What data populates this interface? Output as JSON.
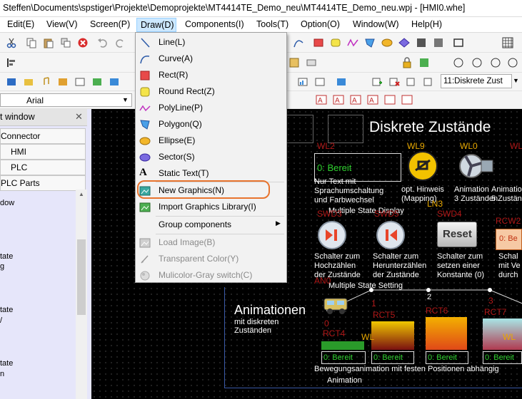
{
  "titlebar": {
    "text": "Steffen\\Documents\\spstiger\\Projekte\\Demoprojekte\\MT4414TE_Demo_neu\\MT4414TE_Demo_neu.wpj - [HMI0.whe]"
  },
  "menubar": {
    "items": [
      "Edit(E)",
      "View(V)",
      "Screen(P)",
      "Draw(D)",
      "Components(I)",
      "Tools(T)",
      "Option(O)",
      "Window(W)",
      "Help(H)"
    ]
  },
  "toolbar": {
    "font_name": "Arial",
    "screen_select": "11:Diskrete Zust"
  },
  "draw_menu": {
    "items": [
      {
        "label": "Line(L)",
        "icon": "line-icon",
        "enabled": true
      },
      {
        "label": "Curve(A)",
        "icon": "curve-icon",
        "enabled": true
      },
      {
        "label": "Rect(R)",
        "icon": "rect-icon",
        "enabled": true
      },
      {
        "label": "Round Rect(Z)",
        "icon": "round-rect-icon",
        "enabled": true
      },
      {
        "label": "PolyLine(P)",
        "icon": "polyline-icon",
        "enabled": true
      },
      {
        "label": "Polygon(Q)",
        "icon": "polygon-icon",
        "enabled": true
      },
      {
        "label": "Ellipse(E)",
        "icon": "ellipse-icon",
        "enabled": true
      },
      {
        "label": "Sector(S)",
        "icon": "sector-icon",
        "enabled": true
      },
      {
        "label": "Static Text(T)",
        "icon": "static-text-icon",
        "enabled": true
      },
      {
        "label": "New Graphics(N)",
        "icon": "new-graphics-icon",
        "enabled": true
      },
      {
        "label": "Import Graphics Library(I)",
        "icon": "import-graphics-icon",
        "enabled": true
      },
      {
        "label": "Group components",
        "icon": "",
        "enabled": true,
        "submenu": true
      },
      {
        "label": "Load Image(B)",
        "icon": "load-image-icon",
        "enabled": false
      },
      {
        "label": "Transparent Color(Y)",
        "icon": "transparent-color-icon",
        "enabled": false
      },
      {
        "label": "Mulicolor-Gray switch(C)",
        "icon": "multicolor-gray-icon",
        "enabled": false
      }
    ]
  },
  "left_panel": {
    "title": "t window",
    "tree": [
      "Connector",
      "HMI",
      "PLC",
      "PLC Parts"
    ],
    "items": [
      "dow",
      "tate",
      "g",
      "tate",
      "/",
      "tate",
      "n"
    ]
  },
  "canvas": {
    "title": "Diskrete Zustände",
    "wl_labels": [
      "WL2",
      "WL9",
      "WL0",
      "WL"
    ],
    "green_text_1": "0: Bereit",
    "desc_1": [
      "Nur Text mit",
      "Sprachumschaltung",
      "und Farbwechsel"
    ],
    "desc_2": [
      "opt. Hinweis",
      "(Mapping)"
    ],
    "desc_3": [
      "Animation",
      "3 Zuständen"
    ],
    "desc_4": [
      "Animation mit A",
      "5 Zuständen"
    ],
    "group_multiple_state_display": "Multiple State Display",
    "ln_label": "LN3",
    "swd_labels": [
      "SWD3",
      "SWD5",
      "SWD4",
      "RCW2"
    ],
    "reset_label": "Reset",
    "bereit_button": "0: Be",
    "btn_desc_1": [
      "Schalter zum",
      "Hochzählen",
      "der Zustände"
    ],
    "btn_desc_2": [
      "Schalter zum",
      "Herunterzählen",
      "der Zustände"
    ],
    "btn_desc_3": [
      "Schalter zum",
      "setzen einer",
      "Konstante (0)"
    ],
    "btn_desc_4": [
      "Schal",
      "mit Ve",
      "durch"
    ],
    "group_multiple_state_setting": "Multiple State Setting",
    "an_label": "AN0",
    "animation_heading": "Animationen",
    "animation_sub": [
      "mit diskreten",
      "Zuständen"
    ],
    "numbers": [
      "0",
      "1",
      "2",
      "3"
    ],
    "rct_labels": [
      "RCT4",
      "RCT5",
      "RCT6",
      "RCT7"
    ],
    "wl_small": [
      "WL",
      "WL"
    ],
    "bereit_labels": [
      "0: Bereit",
      "0: Bereit",
      "0: Bereit",
      "0: Bereit"
    ],
    "bottom_caption": "Bewegungsanimation mit festen Positionen abhängig",
    "animation_group": "Animation",
    "left_letters": [
      "n",
      "n"
    ],
    "left_sub": [
      "nen",
      "nen"
    ]
  }
}
